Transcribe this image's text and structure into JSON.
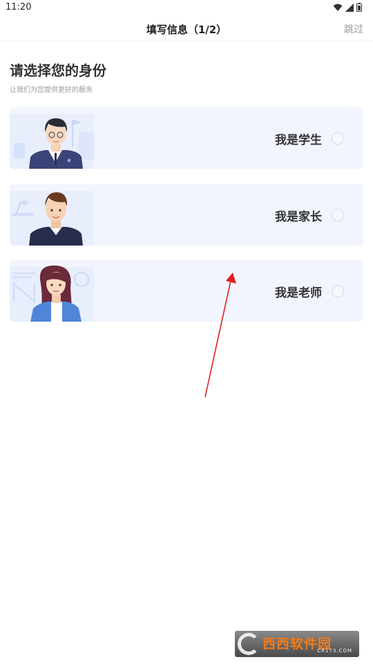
{
  "status_bar": {
    "time": "11:20"
  },
  "header": {
    "title": "填写信息（1/2）",
    "skip_label": "跳过"
  },
  "intro": {
    "heading": "请选择您的身份",
    "subheading": "让我们为您提供更好的服务"
  },
  "roles": [
    {
      "label": "我是学生",
      "selected": false
    },
    {
      "label": "我是家长",
      "selected": false
    },
    {
      "label": "我是老师",
      "selected": false
    }
  ],
  "watermark": {
    "text": "西西软件园",
    "sub": "CR173.COM"
  },
  "colors": {
    "card_bg": "#f2f5fd",
    "arrow": "#e02020",
    "text": "#333333"
  }
}
